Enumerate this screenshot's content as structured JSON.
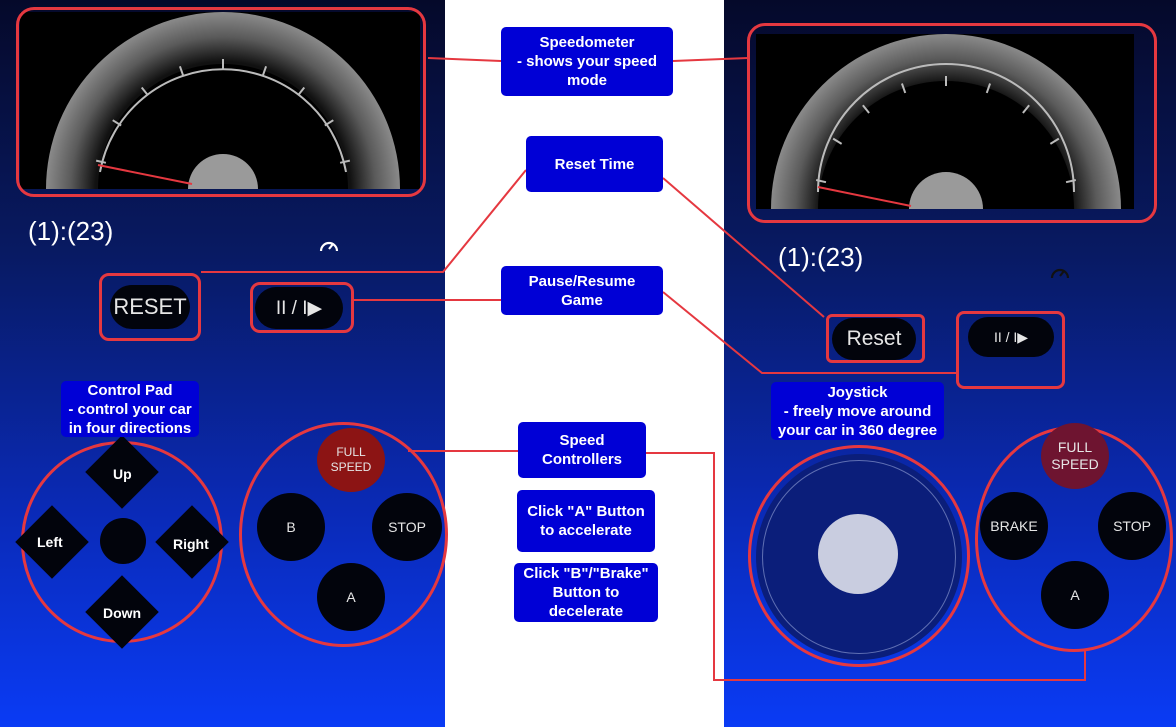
{
  "colors": {
    "callout_bg": "#0000d6",
    "highlight": "#e53840",
    "panel_top": "#05092a",
    "panel_bottom": "#0a3bf5",
    "full_speed_left": "#8c1414",
    "full_speed_right": "#6e1430"
  },
  "left": {
    "timer": "(1):(23)",
    "reset_label": "RESET",
    "pause_label": "II / I▶",
    "speed_buttons": {
      "full_speed": "FULL\nSPEED",
      "b": "B",
      "stop": "STOP",
      "a": "A"
    },
    "dpad": {
      "up": "Up",
      "down": "Down",
      "left": "Left",
      "right": "Right"
    },
    "icons": [
      "speedometer-icon"
    ]
  },
  "right": {
    "timer": "(1):(23)",
    "reset_label": "Reset",
    "pause_label": "II / I▶",
    "speed_buttons": {
      "full_speed": "FULL\nSPEED",
      "brake": "BRAKE",
      "stop": "STOP",
      "a": "A"
    },
    "icons": [
      "speedometer-icon"
    ]
  },
  "callouts": {
    "speedometer": "Speedometer\n- shows your speed\nmode",
    "reset_time": "Reset Time",
    "pause_resume": "Pause/Resume\nGame",
    "control_pad": "Control Pad\n- control your car\nin four directions",
    "joystick": "Joystick\n- freely move around\nyour car in 360 degree",
    "speed_controllers": "Speed\nControllers",
    "click_a": "Click \"A\" Button\nto accelerate",
    "click_b": "Click \"B\"/\"Brake\"\nButton to\ndecelerate"
  },
  "gauge_needle_fraction": 0.0
}
